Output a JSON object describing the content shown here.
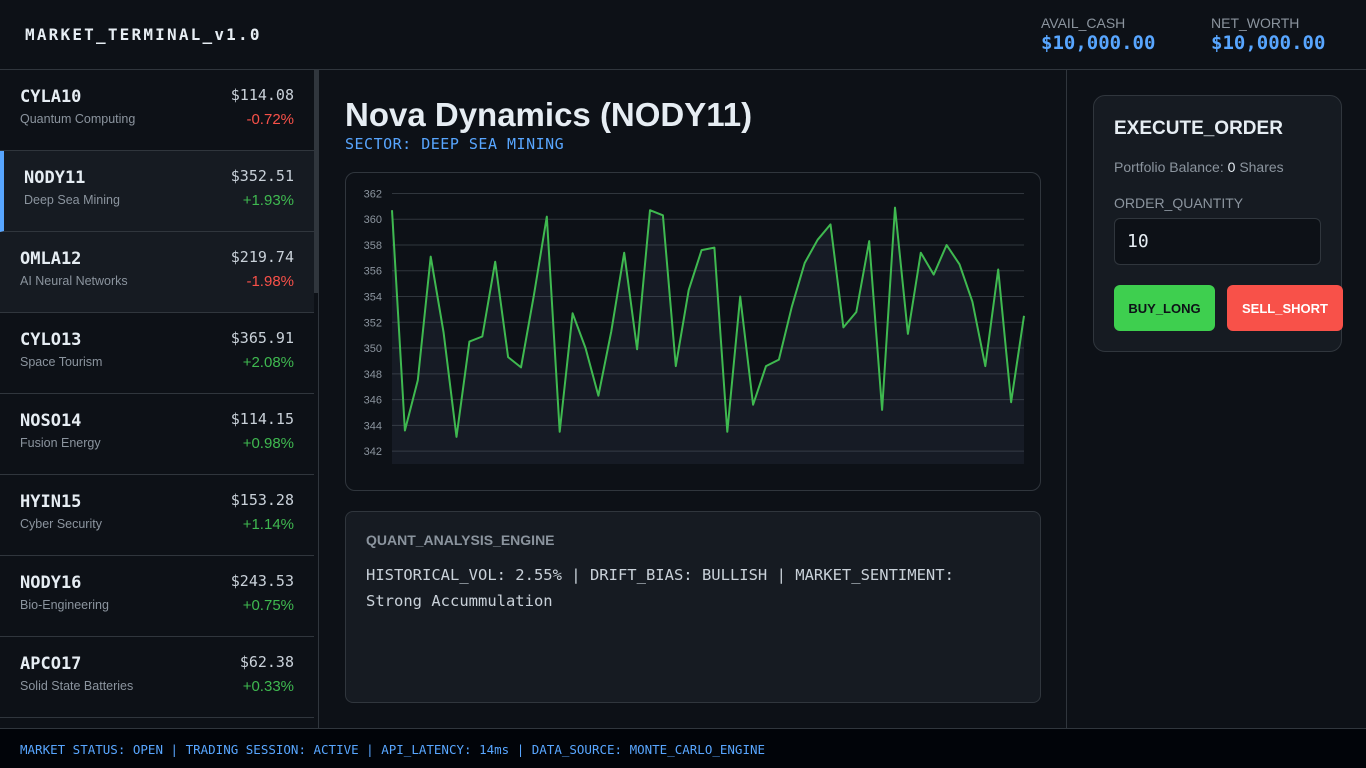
{
  "app": {
    "brand": "MARKET_TERMINAL_v1.0",
    "avail_cash_label": "AVAIL_CASH",
    "avail_cash_value": "$10,000.00",
    "net_worth_label": "NET_WORTH",
    "net_worth_value": "$10,000.00"
  },
  "tickers": [
    {
      "symbol": "CYLA10",
      "name": "Quantum Computing",
      "price": "$114.08",
      "change": "-0.72%",
      "dir": "down",
      "state": ""
    },
    {
      "symbol": "NODY11",
      "name": "Deep Sea Mining",
      "price": "$352.51",
      "change": "+1.93%",
      "dir": "up",
      "state": "sel"
    },
    {
      "symbol": "OMLA12",
      "name": "AI Neural Networks",
      "price": "$219.74",
      "change": "-1.98%",
      "dir": "down",
      "state": "hl"
    },
    {
      "symbol": "CYLO13",
      "name": "Space Tourism",
      "price": "$365.91",
      "change": "+2.08%",
      "dir": "up",
      "state": ""
    },
    {
      "symbol": "NOSO14",
      "name": "Fusion Energy",
      "price": "$114.15",
      "change": "+0.98%",
      "dir": "up",
      "state": ""
    },
    {
      "symbol": "HYIN15",
      "name": "Cyber Security",
      "price": "$153.28",
      "change": "+1.14%",
      "dir": "up",
      "state": ""
    },
    {
      "symbol": "NODY16",
      "name": "Bio-Engineering",
      "price": "$243.53",
      "change": "+0.75%",
      "dir": "up",
      "state": ""
    },
    {
      "symbol": "APCO17",
      "name": "Solid State Batteries",
      "price": "$62.38",
      "change": "+0.33%",
      "dir": "up",
      "state": ""
    }
  ],
  "detail": {
    "title": "Nova Dynamics (NODY11)",
    "sector": "SECTOR: DEEP SEA MINING"
  },
  "chart_data": {
    "type": "line",
    "ylim": [
      341,
      362.5
    ],
    "yticks": [
      342,
      344,
      346,
      348,
      350,
      352,
      354,
      356,
      358,
      360,
      362
    ],
    "grid": true,
    "series": [
      {
        "color": "#3fb950",
        "values": [
          360.7,
          343.6,
          347.5,
          357.1,
          351.2,
          343.1,
          350.5,
          350.9,
          356.7,
          349.3,
          348.5,
          354.1,
          360.2,
          343.5,
          352.7,
          350.0,
          346.3,
          351.3,
          357.4,
          349.9,
          360.7,
          360.3,
          348.6,
          354.5,
          357.6,
          357.8,
          343.5,
          354.0,
          345.6,
          348.6,
          349.1,
          353.2,
          356.6,
          358.4,
          359.6,
          351.6,
          352.8,
          358.3,
          345.2,
          360.9,
          351.1,
          357.4,
          355.7,
          358.0,
          356.5,
          353.6,
          348.6,
          356.1,
          345.8,
          352.5
        ]
      }
    ]
  },
  "quant": {
    "heading": "QUANT_ANALYSIS_ENGINE",
    "text": "HISTORICAL_VOL: 2.55% | DRIFT_BIAS: BULLISH | MARKET_SENTIMENT: Strong Accummulation"
  },
  "order": {
    "title": "EXECUTE_ORDER",
    "balance_label": "Portfolio Balance:",
    "balance_value": "0",
    "balance_unit": "Shares",
    "quantity_label": "ORDER_QUANTITY",
    "quantity_value": "10",
    "buy_label": "BUY_LONG",
    "sell_label": "SELL_SHORT"
  },
  "footer": {
    "text": "MARKET STATUS: OPEN | TRADING SESSION: ACTIVE | API_LATENCY: 14ms | DATA_SOURCE: MONTE_CARLO_ENGINE"
  }
}
